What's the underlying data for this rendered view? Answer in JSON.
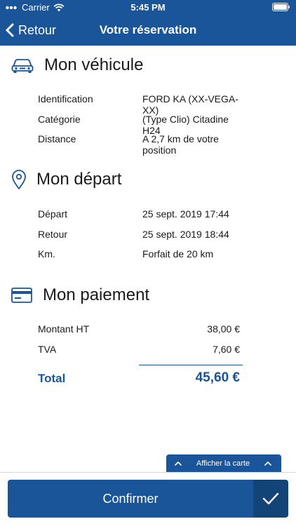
{
  "status_bar": {
    "carrier": "Carrier",
    "time": "5:45 PM"
  },
  "nav": {
    "back_label": "Retour",
    "title": "Votre réservation"
  },
  "vehicle": {
    "title": "Mon véhicule",
    "rows": [
      {
        "label": "Identification",
        "value": "FORD KA (XX-VEGA-XX)"
      },
      {
        "label": "Catégorie",
        "value": "(Type Clio) Citadine H24"
      },
      {
        "label": "Distance",
        "value": "A 2,7 km de votre position"
      }
    ]
  },
  "departure": {
    "title": "Mon départ",
    "rows": [
      {
        "label": "Départ",
        "value": "25 sept. 2019 17:44"
      },
      {
        "label": "Retour",
        "value": "25 sept. 2019 18:44"
      },
      {
        "label": "Km.",
        "value": "Forfait de 20 km"
      }
    ]
  },
  "payment": {
    "title": "Mon paiement",
    "rows": [
      {
        "label": "Montant HT",
        "value": "38,00 €"
      },
      {
        "label": "TVA",
        "value": "7,60 €"
      }
    ],
    "total_label": "Total",
    "total_value": "45,60 €"
  },
  "map_tab": {
    "label": "Afficher la carte"
  },
  "footer": {
    "confirm_label": "Confirmer"
  },
  "colors": {
    "primary": "#1a5499",
    "primary_dark": "#134478",
    "text": "#1a1a1a"
  },
  "icons": {
    "vehicle": "car-icon",
    "departure": "location-pin-icon",
    "payment": "credit-card-icon",
    "confirm": "checkmark-icon"
  }
}
